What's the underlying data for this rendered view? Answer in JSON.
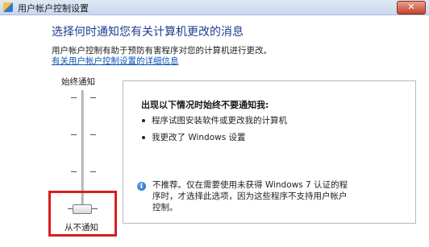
{
  "window": {
    "title": "用户帐户控制设置",
    "close_label": "✕"
  },
  "header": {
    "heading": "选择何时通知您有关计算机更改的消息",
    "description": "用户帐户控制有助于预防有害程序对您的计算机进行更改。",
    "link": "有关用户帐户控制设置的详细信息"
  },
  "slider": {
    "top_label": "始终通知",
    "bottom_label": "从不通知",
    "level": 0,
    "levels": 4
  },
  "panel": {
    "title": "出现以下情况时始终不要通知我:",
    "bullets": [
      "程序试图安装软件或更改我的计算机",
      "我更改了 Windows 设置"
    ],
    "note_lines": [
      "不推荐。仅在需要使用未获得 Windows 7 认证的程",
      "序时，才选择此选项，因为这些程序不支持用户帐户",
      "控制。"
    ]
  },
  "colors": {
    "heading": "#1e3d8f",
    "link": "#0b56b5",
    "highlight": "#d81e1e"
  }
}
